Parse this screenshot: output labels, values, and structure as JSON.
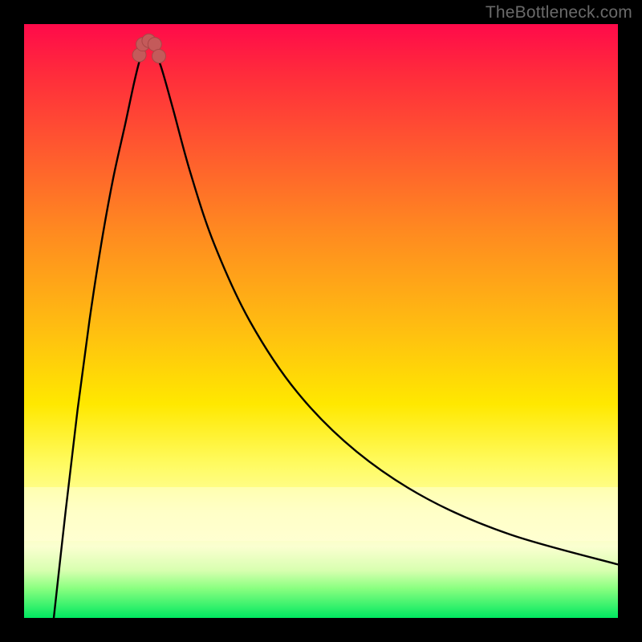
{
  "watermark": {
    "text": "TheBottleneck.com"
  },
  "colors": {
    "background": "#000000",
    "gradient_top": "#ff0a4a",
    "gradient_mid": "#ffe800",
    "gradient_bottom": "#00e860",
    "curve_stroke": "#000000",
    "marker_fill": "#c45a5a",
    "marker_stroke": "#a84646"
  },
  "chart_data": {
    "type": "line",
    "title": "",
    "xlabel": "",
    "ylabel": "",
    "xlim": [
      0,
      100
    ],
    "ylim": [
      0,
      100
    ],
    "notch_x": 21,
    "notch_y": 97,
    "series": [
      {
        "name": "left-branch",
        "x": [
          5,
          7,
          9,
          11,
          13,
          15,
          17,
          18.5,
          19.5,
          20.5
        ],
        "y": [
          0,
          18,
          35,
          50,
          63,
          74,
          83,
          90,
          94,
          96.5
        ]
      },
      {
        "name": "right-branch",
        "x": [
          21.5,
          23,
          25,
          28,
          32,
          38,
          46,
          56,
          68,
          82,
          100
        ],
        "y": [
          96.5,
          93,
          86,
          75,
          63,
          50,
          38,
          28,
          20,
          14,
          9
        ]
      }
    ],
    "markers": {
      "name": "notch-marker",
      "points": [
        {
          "x": 19.4,
          "y": 94.8
        },
        {
          "x": 20.0,
          "y": 96.6
        },
        {
          "x": 21.0,
          "y": 97.2
        },
        {
          "x": 22.0,
          "y": 96.6
        },
        {
          "x": 22.7,
          "y": 94.6
        }
      ]
    }
  }
}
